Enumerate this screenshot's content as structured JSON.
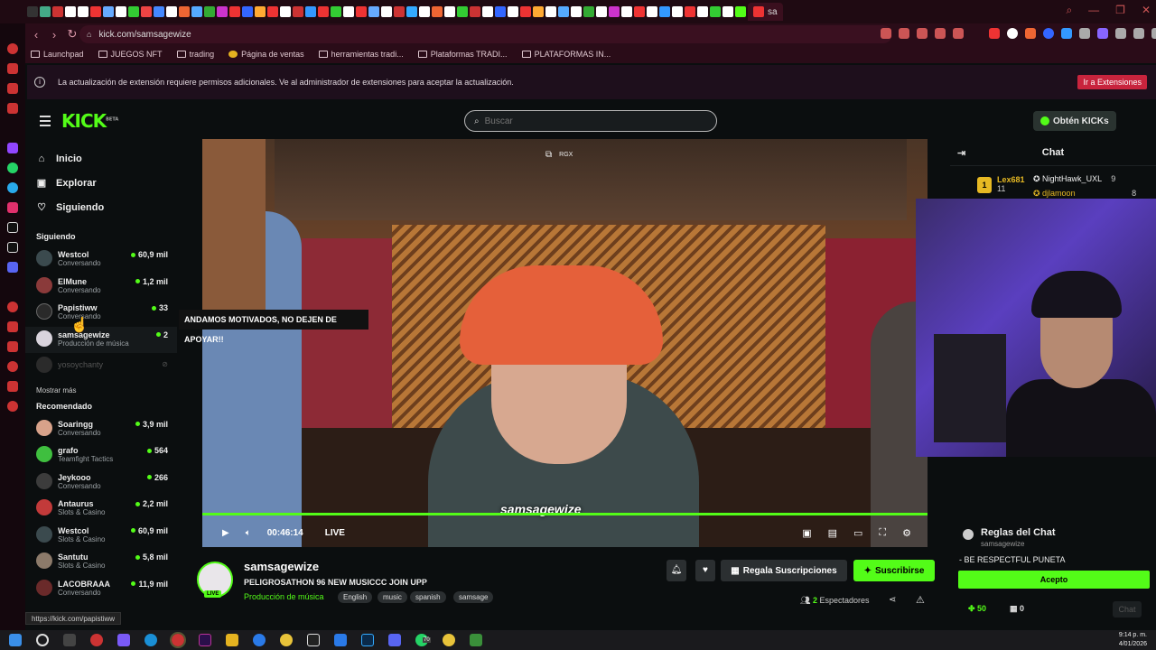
{
  "browser": {
    "active_tab_label": "sa",
    "url": "kick.com/samsagewize",
    "bookmarks": [
      "Launchpad",
      "JUEGOS NFT",
      "trading",
      "Página de ventas",
      "herramientas tradi...",
      "Plataformas TRADI...",
      "PLATAFORMAS IN..."
    ],
    "banner_text": "La actualización de extensión requiere permisos adicionales. Ve al administrador de extensiones para aceptar la actualización.",
    "banner_button": "Ir a Extensiones",
    "hover_url": "https://kick.com/papistiww"
  },
  "header": {
    "logo": "KICK",
    "logo_badge": "BETA",
    "search_placeholder": "Buscar",
    "kicks_button": "Obtén KICKs"
  },
  "sidebar": {
    "nav": [
      {
        "label": "Inicio",
        "icon": "home-icon"
      },
      {
        "label": "Explorar",
        "icon": "explore-icon"
      },
      {
        "label": "Siguiendo",
        "icon": "heart-icon"
      }
    ],
    "following_title": "Siguiendo",
    "following": [
      {
        "name": "Westcol",
        "category": "Conversando",
        "viewers": "60,9 mil",
        "color": "#3b4a4e"
      },
      {
        "name": "ElMune",
        "category": "Conversando",
        "viewers": "1,2 mil",
        "color": "#8a3a3a"
      },
      {
        "name": "Papistiww",
        "category": "Conversando",
        "viewers": "33",
        "color": "#2a2a2a"
      },
      {
        "name": "samsagewize",
        "category": "Producción de música",
        "viewers": "2",
        "color": "#d9d4dd"
      },
      {
        "name": "yosoychanty",
        "category": "",
        "viewers": "",
        "color": "#2b2b2b"
      }
    ],
    "show_more": "Mostrar más",
    "recommended_title": "Recomendado",
    "recommended": [
      {
        "name": "Soaringg",
        "category": "Conversando",
        "viewers": "3,9 mil",
        "color": "#d8a28a"
      },
      {
        "name": "grafo",
        "category": "Teamfight Tactics",
        "viewers": "564",
        "color": "#3fbf3f"
      },
      {
        "name": "Jeykooo",
        "category": "Conversando",
        "viewers": "266",
        "color": "#3c3c3c"
      },
      {
        "name": "Antaurus",
        "category": "Slots & Casino",
        "viewers": "2,2 mil",
        "color": "#c23a3a"
      },
      {
        "name": "Westcol",
        "category": "Slots & Casino",
        "viewers": "60,9 mil",
        "color": "#3b4a4e"
      },
      {
        "name": "Santutu",
        "category": "Slots & Casino",
        "viewers": "5,8 mil",
        "color": "#8c7a6a"
      },
      {
        "name": "LACOBRAAA",
        "category": "Conversando",
        "viewers": "11,9 mil",
        "color": "#6a2a2a"
      }
    ]
  },
  "video": {
    "overlay_label": "RGX",
    "chip": "ANDAMOS MOTIVADOS, NO DEJEN DE APOYAR!!",
    "watermark": "samsagewize",
    "time": "00:46:14",
    "live": "LIVE"
  },
  "stream": {
    "channel": "samsagewize",
    "title": "PELIGROSATHON 96 NEW MUSICCC JOIN UPP",
    "category": "Producción de música",
    "tags": [
      "English",
      "music",
      "spanish",
      "samsage"
    ],
    "gift_button": "Regala Suscripciones",
    "subscribe_button": "Suscribirse",
    "viewers_count": "2",
    "viewers_label": "Espectadores",
    "live_badge": "LIVE"
  },
  "chat": {
    "title": "Chat",
    "top_gifters": [
      {
        "name": "Lex681",
        "count": "11"
      },
      {
        "name": "NightHawk_UXL",
        "count": "9"
      },
      {
        "name": "djlamoon",
        "count": "8"
      }
    ],
    "rules_title": "Reglas del Chat",
    "rules_channel": "samsagewize",
    "rules_text": "- BE RESPECTFUL PUNETA",
    "accept_button": "Acepto",
    "points": "50",
    "points2": "0",
    "send_button": "Chat"
  },
  "taskbar": {
    "time": "9:14 p. m.",
    "date": "4/01/2026",
    "badge": "70"
  },
  "colors": {
    "accent": "#53fc18",
    "banner_button": "#c8243d"
  }
}
